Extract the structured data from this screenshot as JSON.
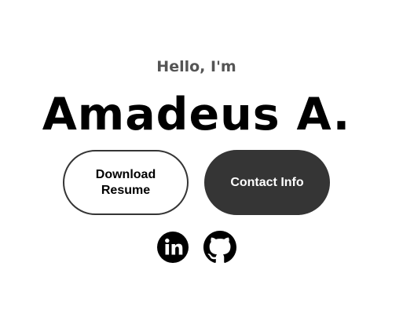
{
  "profile": {
    "greeting": "Hello, I'm",
    "name": "Amadeus A."
  },
  "actions": {
    "resume_label": "Download Resume",
    "contact_label": "Contact Info"
  },
  "social": {
    "icons": [
      "linkedin-icon",
      "github-icon"
    ]
  },
  "colors": {
    "background": "#ffffff",
    "text_primary": "#000000",
    "text_greeting": "#555555",
    "button_dark": "#353535",
    "button_dark_text": "#ffffff"
  }
}
